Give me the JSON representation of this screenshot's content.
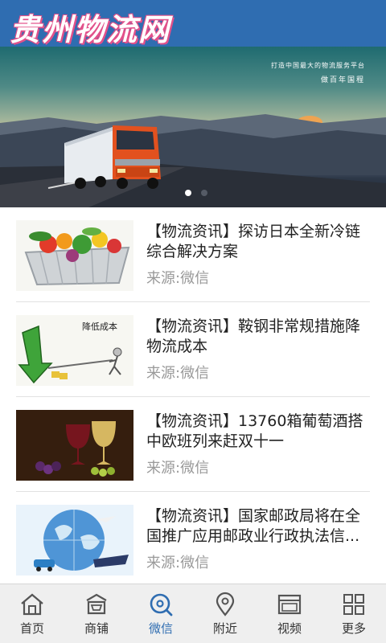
{
  "header": {
    "logo_text": "贵州物流网"
  },
  "banner": {
    "slogan_line1": "打造中国最大的物流服务平台",
    "slogan_line2": "做百年国程"
  },
  "news": [
    {
      "title": "【物流资讯】探访日本全新冷链综合解决方案",
      "source": "来源:微信",
      "thumb": "vegetables-basket-image"
    },
    {
      "title": "【物流资讯】鞍钢非常规措施降物流成本",
      "source": "来源:微信",
      "thumb": "cost-reduction-arrow-image",
      "thumb_caption": "降低成本"
    },
    {
      "title": "【物流资讯】13760箱葡萄酒搭中欧班列来赶双十一",
      "source": "来源:微信",
      "thumb": "wine-glasses-image"
    },
    {
      "title": "【物流资讯】国家邮政局将在全国推广应用邮政业行政执法信...",
      "source": "来源:微信",
      "thumb": "globe-logistics-image"
    }
  ],
  "nav": [
    {
      "label": "首页",
      "icon": "home-icon"
    },
    {
      "label": "商铺",
      "icon": "shop-icon"
    },
    {
      "label": "微信",
      "icon": "wechat-icon",
      "active": true
    },
    {
      "label": "附近",
      "icon": "location-pin-icon"
    },
    {
      "label": "视频",
      "icon": "video-icon"
    },
    {
      "label": "更多",
      "icon": "grid-icon"
    }
  ],
  "colors": {
    "header": "#2f6db1",
    "active_nav": "#2f6db1",
    "logo_outline": "#e2508a"
  }
}
